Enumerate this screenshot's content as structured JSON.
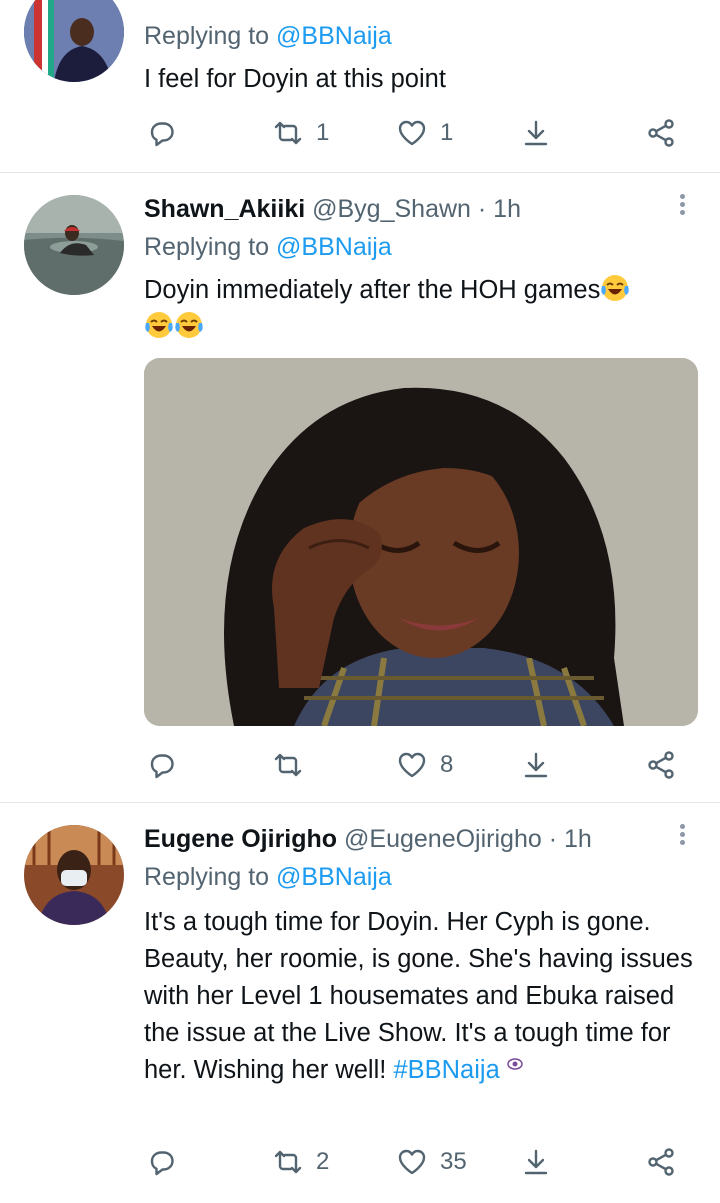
{
  "tweets": [
    {
      "reply_prefix": "Replying to",
      "reply_to": "@BBNaija",
      "text": "I feel for Doyin at this point",
      "retweets": "1",
      "likes": "1"
    },
    {
      "name": "Shawn_Akiiki",
      "handle": "@Byg_Shawn",
      "time": "· 1h",
      "reply_prefix": "Replying to",
      "reply_to": "@BBNaija",
      "text": "Doyin immediately after the HOH games",
      "retweets": "",
      "likes": "8"
    },
    {
      "name": "Eugene Ojirigho",
      "handle": "@EugeneOjirigho",
      "time": "· 1h",
      "reply_prefix": "Replying to",
      "reply_to": "@BBNaija",
      "text": "It's a tough time for Doyin. Her Cyph is gone. Beauty, her roomie, is gone. She's having issues with her Level 1 housemates and Ebuka raised the issue at the Live Show. It's a tough time for her. Wishing her well! ",
      "hashtag": "#BBNaija",
      "retweets": "2",
      "likes": "35"
    }
  ],
  "icons": {
    "reply": "reply-icon",
    "retweet": "retweet-icon",
    "like": "heart-icon",
    "bookmark": "download-icon",
    "share": "share-icon",
    "more": "more-vertical-icon",
    "emoji": "tears-of-joy-emoji",
    "eye": "eye-icon"
  },
  "colors": {
    "link": "#1d9bf0",
    "secondary_text": "#536471",
    "primary_text": "#0f1419",
    "divider": "#e1e6ea"
  }
}
